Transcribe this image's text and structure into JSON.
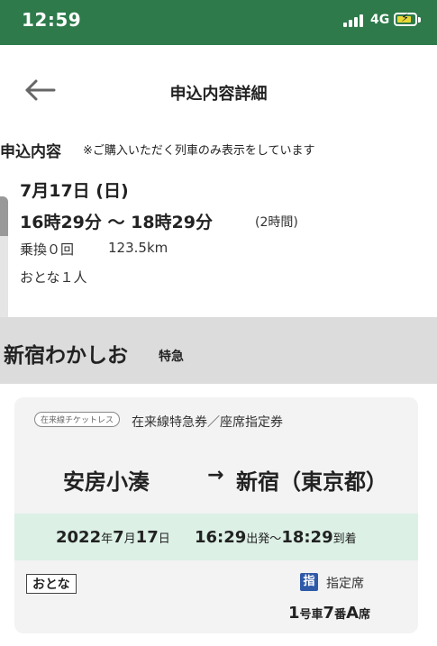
{
  "status_bar": {
    "time": "12:59",
    "network": "4G"
  },
  "header": {
    "title": "申込内容詳細"
  },
  "summary": {
    "section_title": "申込内容",
    "note": "※ご購入いただく列車のみ表示をしています",
    "date": "7月17日 (日)",
    "time_range": "16時29分 〜 18時29分",
    "duration": "(2時間)",
    "transfers": "乗換０回",
    "distance": "123.5km",
    "passengers": "おとな１人"
  },
  "train": {
    "name": "新宿わかしお",
    "type": "特急"
  },
  "ticket": {
    "badge": "在来線チケットレス",
    "kind": "在来線特急券／座席指定券",
    "from": "安房小湊",
    "arrow": "→",
    "to": "新宿（東京都）",
    "schedule_year": "2022",
    "schedule_year_unit": "年",
    "schedule_month": "7",
    "schedule_month_unit": "月",
    "schedule_day": "17",
    "schedule_day_unit": "日",
    "dep_time": "16:29",
    "dep_label": "出発〜",
    "arr_time": "18:29",
    "arr_label": "到着",
    "fare_type": "おとな",
    "seat_icon_label": "指",
    "seat_type": "指定席",
    "car_no": "1",
    "car_unit": "号車",
    "seat_no": "7",
    "seat_no_unit": "番",
    "seat_letter": "A",
    "seat_letter_unit": "席"
  }
}
